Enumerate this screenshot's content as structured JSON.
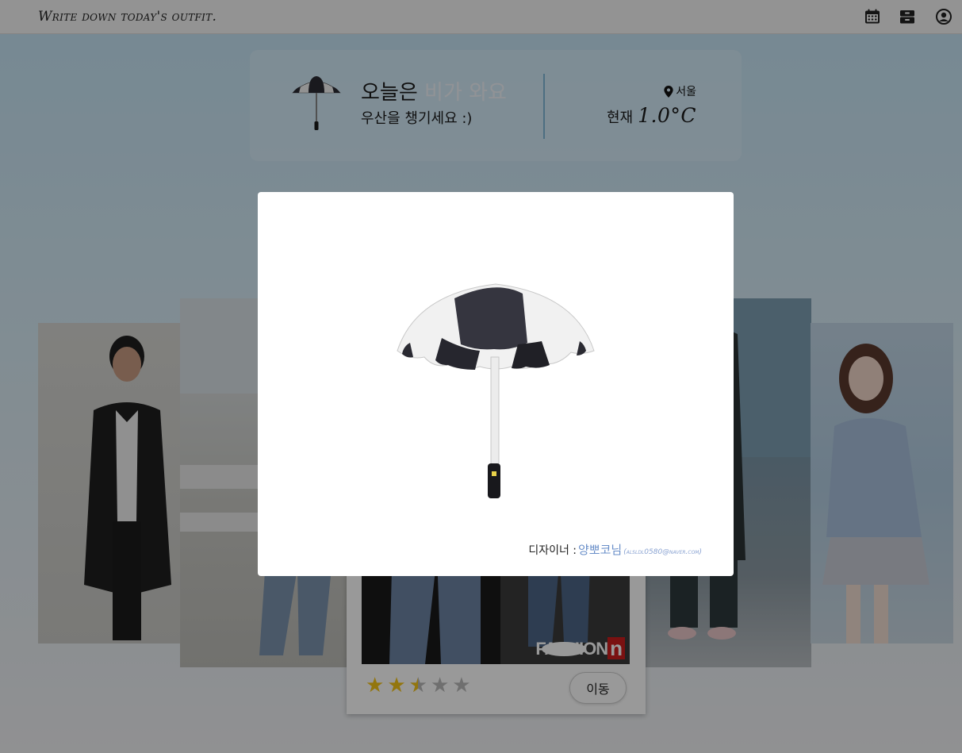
{
  "header": {
    "title": "Write down today's outfit."
  },
  "weather": {
    "line1_prefix": "오늘은",
    "line1_highlight": "비가 와요",
    "line2": "우산을 챙기세요 :)",
    "location": "서울",
    "temp_label": "현재",
    "temp_value": "1.0°C"
  },
  "card": {
    "brand_text": "FASHION",
    "brand_box": "n",
    "rating": 2.5,
    "go_label": "이동"
  },
  "modal": {
    "designer_label": "디자이너 :",
    "designer_name": "양뽀코님",
    "designer_email": "(alsldl0580@naver.com)"
  },
  "colors": {
    "accent": "#6a8fc9",
    "star": "#f5c518",
    "highlight": "#f2f6fa"
  }
}
